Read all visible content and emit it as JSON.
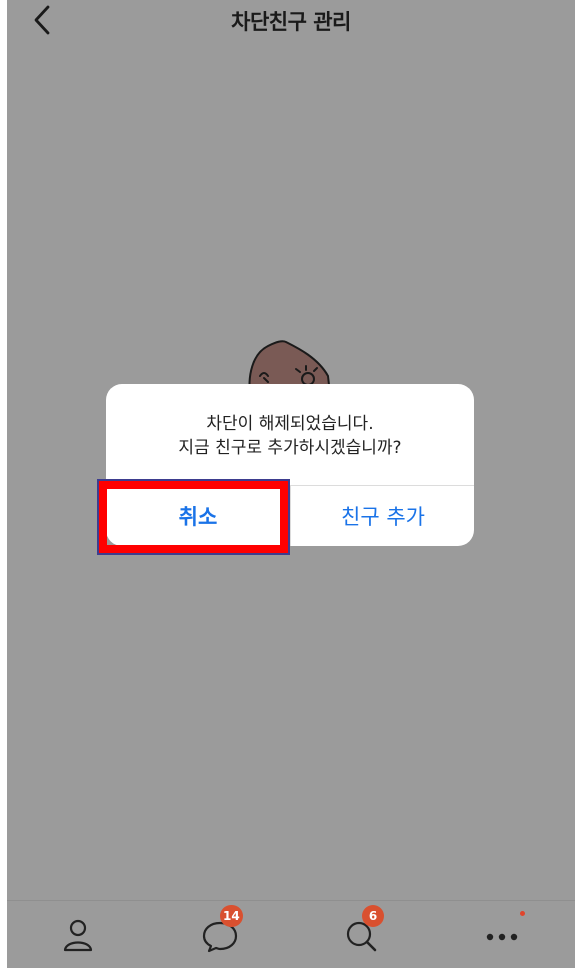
{
  "header": {
    "title": "차단친구 관리",
    "back_icon": "chevron-left-icon"
  },
  "dialog": {
    "message_line1": "차단이 해제되었습니다.",
    "message_line2": "지금 친구로 추가하시겠습니까?",
    "cancel_label": "취소",
    "add_friend_label": "친구 추가"
  },
  "tabbar": {
    "tabs": [
      {
        "name": "friends",
        "icon": "person-icon"
      },
      {
        "name": "chats",
        "icon": "chat-bubble-icon",
        "badge": "14"
      },
      {
        "name": "search",
        "icon": "search-icon",
        "badge": "6"
      },
      {
        "name": "more",
        "icon": "more-dots-icon"
      }
    ]
  },
  "colors": {
    "overlay_bg": "#9b9b9b",
    "accent": "#1a73e8",
    "badge": "#d9502f",
    "highlight": "#ff0000"
  }
}
